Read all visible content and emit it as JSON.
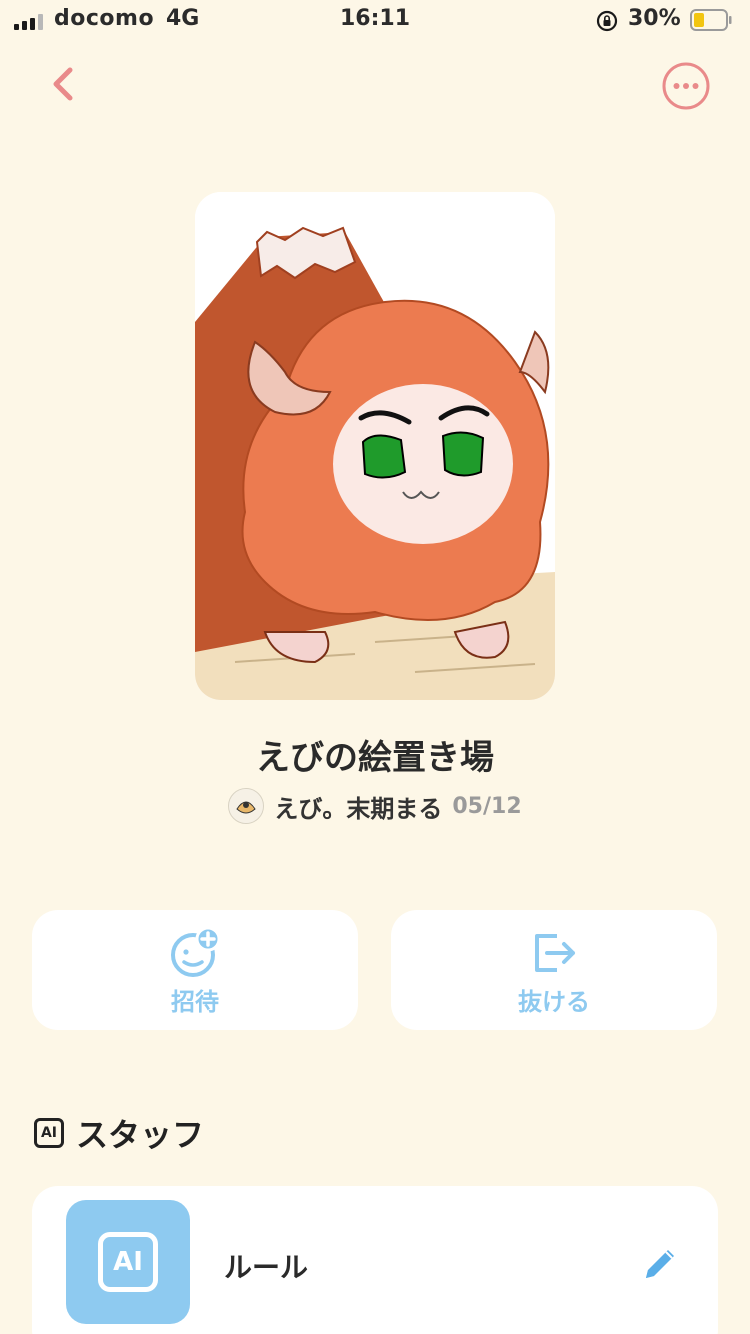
{
  "status_bar": {
    "carrier": "docomo",
    "network": "4G",
    "time": "16:11",
    "battery_percent": "30%"
  },
  "nav": {
    "back_icon": "chevron-left-icon",
    "more_icon": "ellipsis-circle-icon"
  },
  "group": {
    "title": "えびの絵置き場",
    "owner_name": "えび。末期まる",
    "date": "05/12"
  },
  "actions": [
    {
      "label": "招待",
      "icon": "invite-smile-plus-icon"
    },
    {
      "label": "抜ける",
      "icon": "exit-arrow-icon"
    }
  ],
  "staff": {
    "badge_text": "AI",
    "title": "スタッフ",
    "items": [
      {
        "name": "ルール",
        "icon_text": "AI",
        "action_icon": "pencil-icon"
      }
    ]
  },
  "colors": {
    "background": "#fdf7e7",
    "accent_pink": "#e98a8a",
    "accent_blue": "#8ecaf0",
    "card": "#ffffff"
  }
}
